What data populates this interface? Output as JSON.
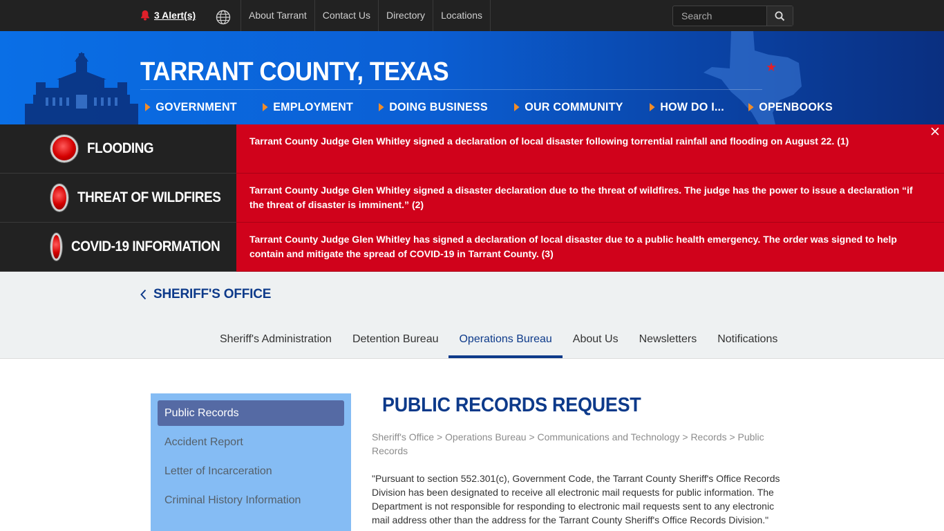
{
  "topbar": {
    "alerts_label": "3 Alert(s)",
    "links": [
      "About Tarrant",
      "Contact Us",
      "Directory",
      "Locations"
    ],
    "search_placeholder": "Search"
  },
  "header": {
    "title": "TARRANT COUNTY, TEXAS",
    "nav": [
      "GOVERNMENT",
      "EMPLOYMENT",
      "DOING BUSINESS",
      "OUR COMMUNITY",
      "HOW DO I...",
      "OPENBOOKS"
    ]
  },
  "alerts": [
    {
      "title": "FLOODING",
      "text": "Tarrant County Judge Glen Whitley signed a declaration of local disaster following torrential rainfall and flooding on August 22. (1)"
    },
    {
      "title": "THREAT OF WILDFIRES",
      "text": "Tarrant County Judge Glen Whitley signed a disaster declaration due to the threat of wildfires. The judge has the power to issue a declaration “if the threat of disaster is imminent.” (2)"
    },
    {
      "title": "COVID-19 INFORMATION",
      "text": "Tarrant County Judge Glen Whitley has signed a declaration of local disaster due to a public health emergency. The order was signed to help contain and mitigate the spread of COVID-19 in Tarrant County. (3)"
    }
  ],
  "subheader": {
    "back_label": "SHERIFF'S OFFICE",
    "tabs": [
      "Sheriff's Administration",
      "Detention Bureau",
      "Operations Bureau",
      "About Us",
      "Newsletters",
      "Notifications"
    ],
    "active_tab": "Operations Bureau"
  },
  "sidebar": {
    "items": [
      "Public Records",
      "Accident Report",
      "Letter of Incarceration",
      "Criminal History Information"
    ]
  },
  "main": {
    "title": "PUBLIC RECORDS REQUEST",
    "breadcrumb": "Sheriff's Office > Operations Bureau > Communications and Technology > Records > Public Records",
    "body": "\"Pursuant to section 552.301(c), Government Code, the Tarrant County Sheriff's Office Records Division has been designated to receive all electronic mail requests for public information. The Department is not responsible for responding to electronic mail requests sent to any electronic mail address other than the address for the Tarrant County Sheriff's Office Records Division.\""
  },
  "colors": {
    "topbar": "#222222",
    "banner_blue": "#0b5fd4",
    "nav_arrow": "#f28c28",
    "alert_red": "#d0021b",
    "brand_navy": "#0d3a8a",
    "sidebar_blue": "#85bcf4",
    "sidebar_active": "#556aa4"
  },
  "icons": [
    "bell-icon",
    "globe-icon",
    "search-icon",
    "close-icon",
    "chevron-left-icon"
  ]
}
